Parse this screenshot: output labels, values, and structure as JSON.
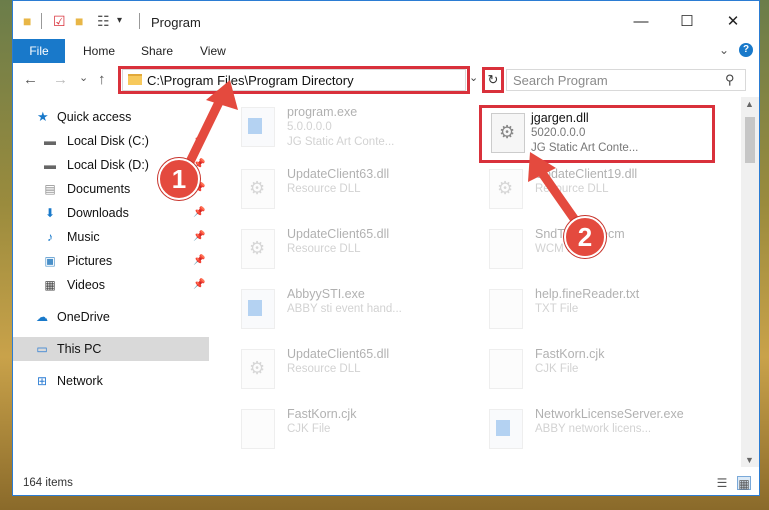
{
  "window": {
    "title": "Program",
    "controls": {
      "minimize": "—",
      "maximize": "☐",
      "close": "✕"
    }
  },
  "ribbon": {
    "file_tab": "File",
    "tabs": [
      "Home",
      "Share",
      "View"
    ],
    "help": "?"
  },
  "navbar": {
    "back": "←",
    "forward": "→",
    "recent": "⌄",
    "up": "↑",
    "address": "C:\\Program Files\\Program Directory",
    "refresh": "↻",
    "search_placeholder": "Search Program"
  },
  "sidebar": {
    "items": [
      {
        "label": "Quick access",
        "icon": "star-icon",
        "pinned": false
      },
      {
        "label": "Local Disk (C:)",
        "icon": "drive-icon",
        "pinned": true
      },
      {
        "label": "Local Disk (D:)",
        "icon": "drive-icon",
        "pinned": true
      },
      {
        "label": "Documents",
        "icon": "documents-icon",
        "pinned": true
      },
      {
        "label": "Downloads",
        "icon": "downloads-icon",
        "pinned": true
      },
      {
        "label": "Music",
        "icon": "music-icon",
        "pinned": true
      },
      {
        "label": "Pictures",
        "icon": "pictures-icon",
        "pinned": true
      },
      {
        "label": "Videos",
        "icon": "videos-icon",
        "pinned": true
      },
      {
        "label": "OneDrive",
        "icon": "onedrive-icon",
        "pinned": false
      },
      {
        "label": "This PC",
        "icon": "pc-icon",
        "pinned": false,
        "active": true
      },
      {
        "label": "Network",
        "icon": "network-icon",
        "pinned": false
      }
    ]
  },
  "files": [
    {
      "name": "program.exe",
      "line1": "5.0.0.0.0",
      "line2": "JG Static Art Conte...",
      "icon": "exe-icon",
      "faded": true
    },
    {
      "name": "jgargen.dll",
      "line1": "5020.0.0.0",
      "line2": "JG Static Art Conte...",
      "icon": "gear-file-icon",
      "faded": false
    },
    {
      "name": "UpdateClient63.dll",
      "line1": "Resource DLL",
      "line2": "",
      "icon": "gear-file-icon",
      "faded": true
    },
    {
      "name": "UpdateClient19.dll",
      "line1": "Resource DLL",
      "line2": "",
      "icon": "gear-file-icon",
      "faded": true
    },
    {
      "name": "UpdateClient65.dll",
      "line1": "Resource DLL",
      "line2": "",
      "icon": "gear-file-icon",
      "faded": true
    },
    {
      "name": "SndToolbar.ecm",
      "line1": "WCM File",
      "line2": "",
      "icon": "blank-file-icon",
      "faded": true
    },
    {
      "name": "AbbyySTI.exe",
      "line1": "ABBY sti event hand...",
      "line2": "",
      "icon": "exe-icon",
      "faded": true
    },
    {
      "name": "help.fineReader.txt",
      "line1": "TXT File",
      "line2": "",
      "icon": "blank-file-icon",
      "faded": true
    },
    {
      "name": "UpdateClient65.dll",
      "line1": "Resource DLL",
      "line2": "",
      "icon": "gear-file-icon",
      "faded": true
    },
    {
      "name": "FastKorn.cjk",
      "line1": "CJK File",
      "line2": "",
      "icon": "blank-file-icon",
      "faded": true
    },
    {
      "name": "FastKorn.cjk",
      "line1": "CJK File",
      "line2": "",
      "icon": "blank-file-icon",
      "faded": true
    },
    {
      "name": "NetworkLicenseServer.exe",
      "line1": "ABBY network licens...",
      "line2": "",
      "icon": "exe-icon",
      "faded": true
    }
  ],
  "status": {
    "count": "164 items"
  },
  "annotations": {
    "step1": "1",
    "step2": "2"
  },
  "colors": {
    "accent": "#1979ca",
    "highlight": "#d9313b",
    "arrow": "#e44a3e"
  }
}
